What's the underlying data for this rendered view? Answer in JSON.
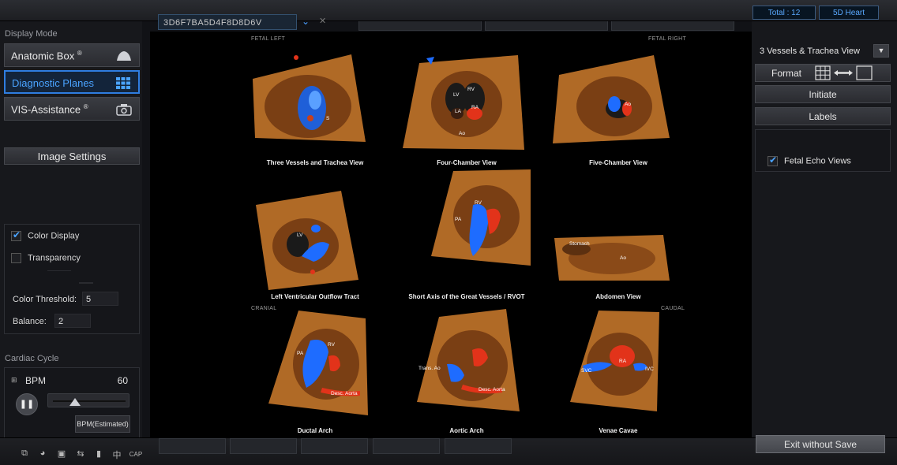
{
  "topbar": {
    "volume_id": "3D6F7BA5D4F8D8D6V",
    "total": "Total : 12",
    "mode": "5D Heart"
  },
  "left_panel": {
    "display_mode_label": "Display Mode",
    "mode_buttons": [
      {
        "label": "Anatomic Box",
        "sup": "®"
      },
      {
        "label": "Diagnostic Planes",
        "sup": ""
      },
      {
        "label": "VIS-Assistance",
        "sup": "®"
      }
    ],
    "image_settings_label": "Image Settings",
    "color_display_label": "Color Display",
    "color_display_checked": true,
    "transparency_label": "Transparency",
    "transparency_checked": false,
    "color_threshold_label": "Color Threshold:",
    "color_threshold_value": "5",
    "balance_label": "Balance:",
    "balance_value": "2",
    "cardiac_cycle_label": "Cardiac Cycle",
    "bpm_label": "BPM",
    "bpm_value": "60",
    "bpm_slider_fraction": 0.3,
    "bpm_estimated_label": "BPM(Estimated)"
  },
  "viewport": {
    "corner_top_left": "FETAL LEFT",
    "corner_top_right": "FETAL RIGHT",
    "corner_mid_left": "CRANIAL",
    "corner_mid_right": "CAUDAL",
    "planes": [
      {
        "title": "Three Vessels and Trachea View",
        "labels": [
          "S"
        ]
      },
      {
        "title": "Four-Chamber View",
        "labels": [
          "LV",
          "RV",
          "RA",
          "LA",
          "Ao"
        ]
      },
      {
        "title": "Five-Chamber View",
        "labels": [
          "Ao"
        ]
      },
      {
        "title": "Left Ventricular Outflow Tract",
        "labels": [
          "LV"
        ]
      },
      {
        "title": "Short Axis of the Great Vessels / RVOT",
        "labels": [
          "RV",
          "PA"
        ]
      },
      {
        "title": "Abdomen View",
        "labels": [
          "Stomach",
          "Ao"
        ]
      },
      {
        "title": "Ductal Arch",
        "labels": [
          "RV",
          "PA",
          "Desc. Aorta"
        ]
      },
      {
        "title": "Aortic Arch",
        "labels": [
          "Trans. Ao",
          "Desc. Aorta"
        ]
      },
      {
        "title": "Venae Cavae",
        "labels": [
          "RA",
          "SVC",
          "IVC"
        ]
      }
    ]
  },
  "right_panel": {
    "view_select": "3 Vessels & Trachea View",
    "format_label": "Format",
    "initiate_label": "Initiate",
    "labels_label": "Labels",
    "fetal_echo_label": "Fetal Echo Views",
    "fetal_echo_checked": true
  },
  "bottombar": {
    "cap_label": "CAP",
    "han_label": "中",
    "exit_label": "Exit without Save"
  },
  "colors": {
    "accent": "#2f7de0",
    "accent_text": "#4aa3ff",
    "doppler_blue": "#1e6cff",
    "doppler_red": "#e2331a",
    "tissue": "#c77a2c"
  }
}
